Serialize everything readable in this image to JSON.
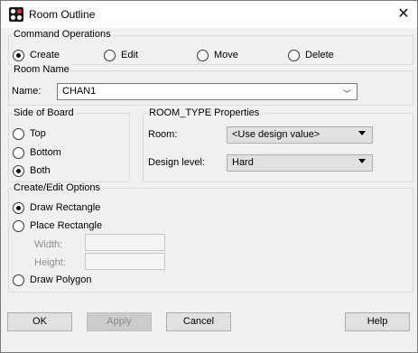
{
  "window": {
    "title": "Room Outline",
    "close_glyph": "✕"
  },
  "command_operations": {
    "title": "Command Operations",
    "options": [
      "Create",
      "Edit",
      "Move",
      "Delete"
    ],
    "selected": "Create"
  },
  "room_name": {
    "title": "Room Name",
    "label": "Name:",
    "value": "CHAN1",
    "dropdown_glyph": "﹀"
  },
  "side_of_board": {
    "title": "Side of Board",
    "options": [
      "Top",
      "Bottom",
      "Both"
    ],
    "selected": "Both"
  },
  "room_type": {
    "title": "ROOM_TYPE Properties",
    "room_label": "Room:",
    "room_value": "<Use design value>",
    "design_level_label": "Design level:",
    "design_level_value": "Hard"
  },
  "create_edit": {
    "title": "Create/Edit Options",
    "draw_rectangle": "Draw Rectangle",
    "place_rectangle": "Place Rectangle",
    "width_label": "Width:",
    "height_label": "Height:",
    "draw_polygon": "Draw Polygon",
    "selected": "Draw Rectangle"
  },
  "buttons": {
    "ok": "OK",
    "apply": "Apply",
    "cancel": "Cancel",
    "help": "Help"
  },
  "icons": {
    "app": "room-outline-app-icon",
    "close": "close-icon",
    "dropdown": "chevron-down-icon"
  },
  "colors": {
    "title_bg": "#ffffff",
    "window_bg": "#f0f0f0",
    "button_bg": "#e1e1e1",
    "disabled_text": "#8c8c8c"
  }
}
